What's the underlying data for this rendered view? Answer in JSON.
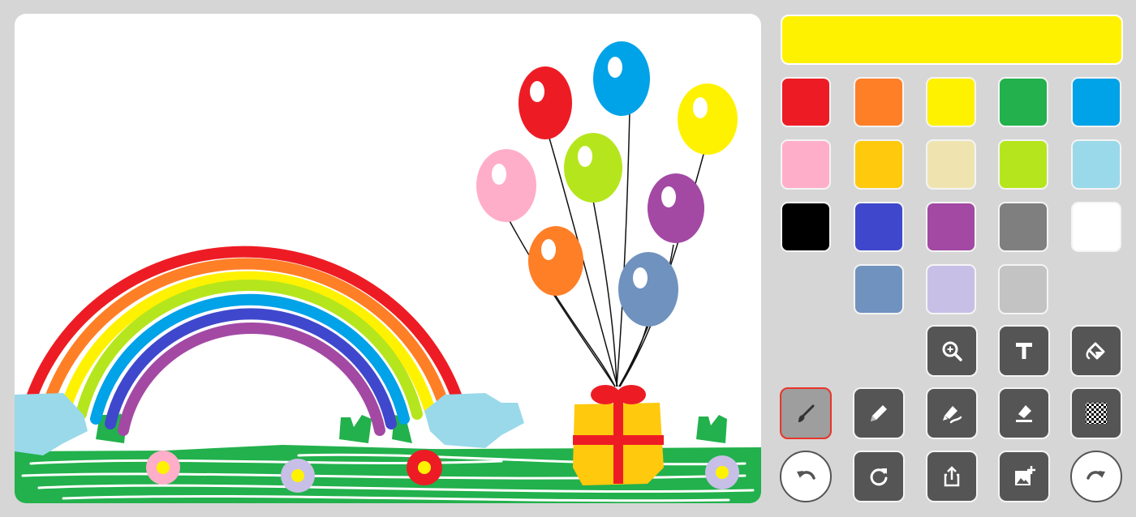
{
  "current_color": "#fff200",
  "palette": [
    {
      "name": "red",
      "color": "#ed1c24"
    },
    {
      "name": "orange",
      "color": "#ff7f27"
    },
    {
      "name": "yellow",
      "color": "#fff200"
    },
    {
      "name": "green",
      "color": "#22b14c"
    },
    {
      "name": "blue",
      "color": "#00a2e8"
    },
    {
      "name": "pink",
      "color": "#ffaec9"
    },
    {
      "name": "gold",
      "color": "#ffc90e"
    },
    {
      "name": "beige",
      "color": "#efe4b0"
    },
    {
      "name": "lime",
      "color": "#b5e61d"
    },
    {
      "name": "light-blue",
      "color": "#99d9ea"
    },
    {
      "name": "black",
      "color": "#000000"
    },
    {
      "name": "indigo",
      "color": "#3f48cc"
    },
    {
      "name": "purple",
      "color": "#a349a4"
    },
    {
      "name": "gray",
      "color": "#7f7f7f"
    },
    {
      "name": "white",
      "color": "#ffffff"
    },
    {
      "name": "steel-blue",
      "color": "#7092be"
    },
    {
      "name": "lavender",
      "color": "#c8bfe7"
    },
    {
      "name": "silver",
      "color": "#c3c3c3"
    }
  ],
  "tools": {
    "zoom": {
      "icon": "zoom-in-icon"
    },
    "text": {
      "icon": "text-icon"
    },
    "fill": {
      "icon": "paint-bucket-icon"
    },
    "brush": {
      "icon": "brush-icon",
      "active": true
    },
    "pencil": {
      "icon": "pencil-icon"
    },
    "marker": {
      "icon": "marker-icon"
    },
    "eraser": {
      "icon": "eraser-icon"
    },
    "pattern": {
      "icon": "checkerboard-icon"
    },
    "undo": {
      "icon": "undo-icon"
    },
    "reset": {
      "icon": "refresh-icon"
    },
    "share": {
      "icon": "share-icon"
    },
    "add_image": {
      "icon": "add-image-icon"
    },
    "redo": {
      "icon": "redo-icon"
    }
  }
}
